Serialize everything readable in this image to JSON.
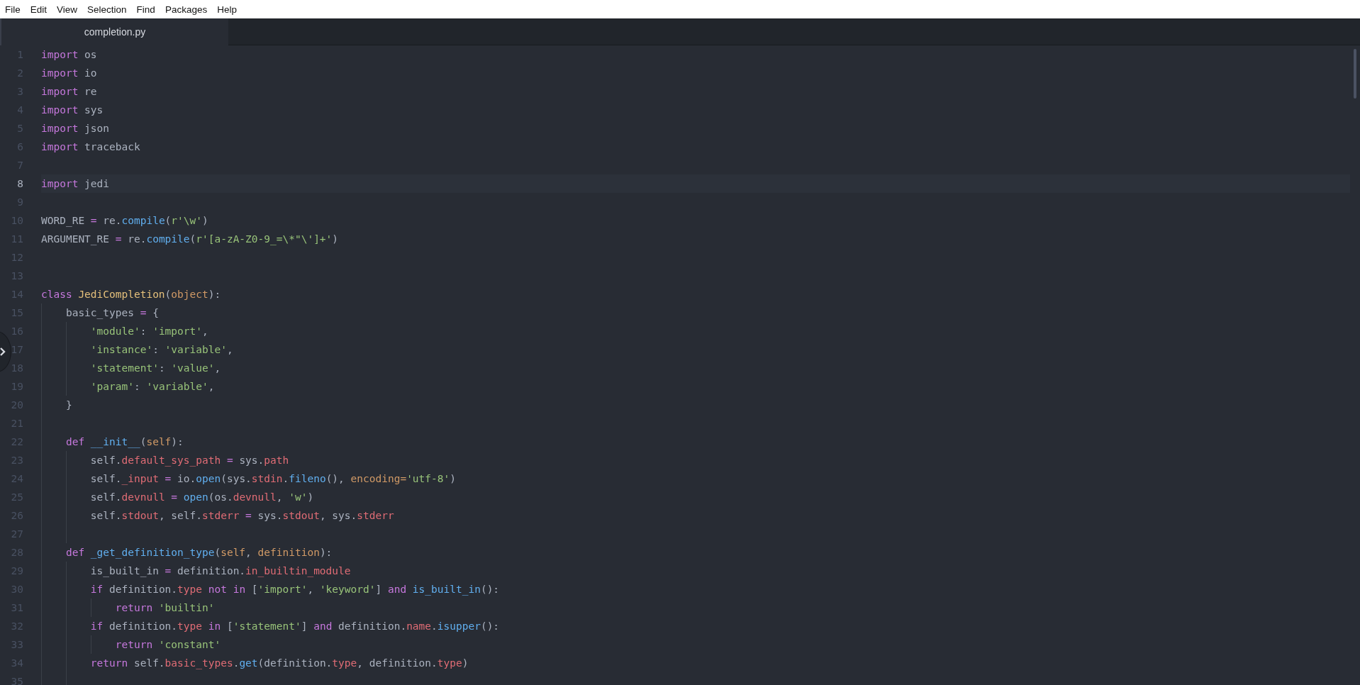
{
  "menu": [
    "File",
    "Edit",
    "View",
    "Selection",
    "Find",
    "Packages",
    "Help"
  ],
  "tabs": [
    {
      "label": "completion.py",
      "selected": true
    }
  ],
  "editor": {
    "lines": [
      {
        "number": "1",
        "current": false,
        "tokens": [
          {
            "text": "import",
            "kind": "keyword"
          },
          {
            "text": " os",
            "kind": "plain"
          }
        ]
      },
      {
        "number": "2",
        "current": false,
        "tokens": [
          {
            "text": "import",
            "kind": "keyword"
          },
          {
            "text": " io",
            "kind": "plain"
          }
        ]
      },
      {
        "number": "3",
        "current": false,
        "tokens": [
          {
            "text": "import",
            "kind": "keyword"
          },
          {
            "text": " re",
            "kind": "plain"
          }
        ]
      },
      {
        "number": "4",
        "current": false,
        "tokens": [
          {
            "text": "import",
            "kind": "keyword"
          },
          {
            "text": " sys",
            "kind": "plain"
          }
        ]
      },
      {
        "number": "5",
        "current": false,
        "tokens": [
          {
            "text": "import",
            "kind": "keyword"
          },
          {
            "text": " json",
            "kind": "plain"
          }
        ]
      },
      {
        "number": "6",
        "current": false,
        "tokens": [
          {
            "text": "import",
            "kind": "keyword"
          },
          {
            "text": " traceback",
            "kind": "plain"
          }
        ]
      },
      {
        "number": "7",
        "current": false
      },
      {
        "number": "8",
        "current": true,
        "tokens": [
          {
            "text": "import",
            "kind": "keyword"
          },
          {
            "text": " jedi",
            "kind": "plain"
          }
        ]
      },
      {
        "number": "9",
        "current": false
      },
      {
        "number": "10",
        "current": false,
        "tokens": [
          {
            "text": "WORD_RE ",
            "kind": "plain"
          },
          {
            "text": "=",
            "kind": "keyword"
          },
          {
            "text": " re.",
            "kind": "plain"
          },
          {
            "text": "compile",
            "kind": "function"
          },
          {
            "text": "(",
            "kind": "plain"
          },
          {
            "text": "r'\\w'",
            "kind": "string"
          },
          {
            "text": ")",
            "kind": "plain"
          }
        ]
      },
      {
        "number": "11",
        "current": false,
        "tokens": [
          {
            "text": "ARGUMENT_RE ",
            "kind": "plain"
          },
          {
            "text": "=",
            "kind": "keyword"
          },
          {
            "text": " re.",
            "kind": "plain"
          },
          {
            "text": "compile",
            "kind": "function"
          },
          {
            "text": "(",
            "kind": "plain"
          },
          {
            "text": "r'[a-zA-Z0-9_=\\*\"\\']+'",
            "kind": "string"
          },
          {
            "text": ")",
            "kind": "plain"
          }
        ]
      },
      {
        "number": "12",
        "current": false
      },
      {
        "number": "13",
        "current": false
      },
      {
        "number": "14",
        "current": false,
        "tokens": [
          {
            "text": "class",
            "kind": "keyword"
          },
          {
            "text": " JediCompletion",
            "kind": "class"
          },
          {
            "text": "(",
            "kind": "plain"
          },
          {
            "text": "object",
            "kind": "param"
          },
          {
            "text": "):",
            "kind": "plain"
          }
        ]
      },
      {
        "number": "15",
        "current": false,
        "tokens": [
          {
            "text": "    basic_types ",
            "kind": "plain"
          },
          {
            "text": "=",
            "kind": "keyword"
          },
          {
            "text": " {",
            "kind": "plain"
          }
        ]
      },
      {
        "number": "16",
        "current": false,
        "tokens": [
          {
            "text": "        'module'",
            "kind": "string"
          },
          {
            "text": ": ",
            "kind": "plain"
          },
          {
            "text": "'import'",
            "kind": "string"
          },
          {
            "text": ",",
            "kind": "plain"
          }
        ]
      },
      {
        "number": "17",
        "current": false,
        "tokens": [
          {
            "text": "        'instance'",
            "kind": "string"
          },
          {
            "text": ": ",
            "kind": "plain"
          },
          {
            "text": "'variable'",
            "kind": "string"
          },
          {
            "text": ",",
            "kind": "plain"
          }
        ]
      },
      {
        "number": "18",
        "current": false,
        "tokens": [
          {
            "text": "        'statement'",
            "kind": "string"
          },
          {
            "text": ": ",
            "kind": "plain"
          },
          {
            "text": "'value'",
            "kind": "string"
          },
          {
            "text": ",",
            "kind": "plain"
          }
        ]
      },
      {
        "number": "19",
        "current": false,
        "tokens": [
          {
            "text": "        'param'",
            "kind": "string"
          },
          {
            "text": ": ",
            "kind": "plain"
          },
          {
            "text": "'variable'",
            "kind": "string"
          },
          {
            "text": ",",
            "kind": "plain"
          }
        ]
      },
      {
        "number": "20",
        "current": false,
        "tokens": [
          {
            "text": "    }",
            "kind": "plain"
          }
        ]
      },
      {
        "number": "21",
        "current": false
      },
      {
        "number": "22",
        "current": false,
        "tokens": [
          {
            "text": "    def",
            "kind": "keyword"
          },
          {
            "text": " __init__",
            "kind": "function"
          },
          {
            "text": "(",
            "kind": "plain"
          },
          {
            "text": "self",
            "kind": "param"
          },
          {
            "text": "):",
            "kind": "plain"
          }
        ]
      },
      {
        "number": "23",
        "current": false,
        "tokens": [
          {
            "text": "        self.",
            "kind": "plain"
          },
          {
            "text": "default_sys_path",
            "kind": "property"
          },
          {
            "text": " =",
            "kind": "keyword"
          },
          {
            "text": " sys.",
            "kind": "plain"
          },
          {
            "text": "path",
            "kind": "property"
          }
        ]
      },
      {
        "number": "24",
        "current": false,
        "tokens": [
          {
            "text": "        self.",
            "kind": "plain"
          },
          {
            "text": "_input",
            "kind": "property"
          },
          {
            "text": " =",
            "kind": "keyword"
          },
          {
            "text": " io.",
            "kind": "plain"
          },
          {
            "text": "open",
            "kind": "function"
          },
          {
            "text": "(sys.",
            "kind": "plain"
          },
          {
            "text": "stdin",
            "kind": "property"
          },
          {
            "text": ".",
            "kind": "plain"
          },
          {
            "text": "fileno",
            "kind": "function"
          },
          {
            "text": "(), ",
            "kind": "plain"
          },
          {
            "text": "encoding=",
            "kind": "param"
          },
          {
            "text": "'utf-8'",
            "kind": "string"
          },
          {
            "text": ")",
            "kind": "plain"
          }
        ]
      },
      {
        "number": "25",
        "current": false,
        "tokens": [
          {
            "text": "        self.",
            "kind": "plain"
          },
          {
            "text": "devnull",
            "kind": "property"
          },
          {
            "text": " =",
            "kind": "keyword"
          },
          {
            "text": " open",
            "kind": "function"
          },
          {
            "text": "(os.",
            "kind": "plain"
          },
          {
            "text": "devnull",
            "kind": "property"
          },
          {
            "text": ", ",
            "kind": "plain"
          },
          {
            "text": "'w'",
            "kind": "string"
          },
          {
            "text": ")",
            "kind": "plain"
          }
        ]
      },
      {
        "number": "26",
        "current": false,
        "tokens": [
          {
            "text": "        self.",
            "kind": "plain"
          },
          {
            "text": "stdout",
            "kind": "property"
          },
          {
            "text": ", self.",
            "kind": "plain"
          },
          {
            "text": "stderr",
            "kind": "property"
          },
          {
            "text": " =",
            "kind": "keyword"
          },
          {
            "text": " sys.",
            "kind": "plain"
          },
          {
            "text": "stdout",
            "kind": "property"
          },
          {
            "text": ", sys.",
            "kind": "plain"
          },
          {
            "text": "stderr",
            "kind": "property"
          }
        ]
      },
      {
        "number": "27",
        "current": false
      },
      {
        "number": "28",
        "current": false,
        "tokens": [
          {
            "text": "    def",
            "kind": "keyword"
          },
          {
            "text": " _get_definition_type",
            "kind": "function"
          },
          {
            "text": "(",
            "kind": "plain"
          },
          {
            "text": "self",
            "kind": "param"
          },
          {
            "text": ", ",
            "kind": "plain"
          },
          {
            "text": "definition",
            "kind": "param"
          },
          {
            "text": "):",
            "kind": "plain"
          }
        ]
      },
      {
        "number": "29",
        "current": false,
        "tokens": [
          {
            "text": "        is_built_in ",
            "kind": "plain"
          },
          {
            "text": "=",
            "kind": "keyword"
          },
          {
            "text": " definition.",
            "kind": "plain"
          },
          {
            "text": "in_builtin_module",
            "kind": "property"
          }
        ]
      },
      {
        "number": "30",
        "current": false,
        "tokens": [
          {
            "text": "        if",
            "kind": "keyword"
          },
          {
            "text": " definition.",
            "kind": "plain"
          },
          {
            "text": "type",
            "kind": "property"
          },
          {
            "text": " not in",
            "kind": "keyword"
          },
          {
            "text": " [",
            "kind": "plain"
          },
          {
            "text": "'import'",
            "kind": "string"
          },
          {
            "text": ", ",
            "kind": "plain"
          },
          {
            "text": "'keyword'",
            "kind": "string"
          },
          {
            "text": "] ",
            "kind": "plain"
          },
          {
            "text": "and",
            "kind": "keyword"
          },
          {
            "text": " is_built_in",
            "kind": "function"
          },
          {
            "text": "():",
            "kind": "plain"
          }
        ]
      },
      {
        "number": "31",
        "current": false,
        "tokens": [
          {
            "text": "            return",
            "kind": "keyword"
          },
          {
            "text": " 'builtin'",
            "kind": "string"
          }
        ]
      },
      {
        "number": "32",
        "current": false,
        "tokens": [
          {
            "text": "        if",
            "kind": "keyword"
          },
          {
            "text": " definition.",
            "kind": "plain"
          },
          {
            "text": "type",
            "kind": "property"
          },
          {
            "text": " in",
            "kind": "keyword"
          },
          {
            "text": " [",
            "kind": "plain"
          },
          {
            "text": "'statement'",
            "kind": "string"
          },
          {
            "text": "] ",
            "kind": "plain"
          },
          {
            "text": "and",
            "kind": "keyword"
          },
          {
            "text": " definition.",
            "kind": "plain"
          },
          {
            "text": "name",
            "kind": "property"
          },
          {
            "text": ".",
            "kind": "plain"
          },
          {
            "text": "isupper",
            "kind": "function"
          },
          {
            "text": "():",
            "kind": "plain"
          }
        ]
      },
      {
        "number": "33",
        "current": false,
        "tokens": [
          {
            "text": "            return",
            "kind": "keyword"
          },
          {
            "text": " 'constant'",
            "kind": "string"
          }
        ]
      },
      {
        "number": "34",
        "current": false,
        "tokens": [
          {
            "text": "        return",
            "kind": "keyword"
          },
          {
            "text": " self.",
            "kind": "plain"
          },
          {
            "text": "basic_types",
            "kind": "property"
          },
          {
            "text": ".",
            "kind": "plain"
          },
          {
            "text": "get",
            "kind": "function"
          },
          {
            "text": "(definition.",
            "kind": "plain"
          },
          {
            "text": "type",
            "kind": "property"
          },
          {
            "text": ", definition.",
            "kind": "plain"
          },
          {
            "text": "type",
            "kind": "property"
          },
          {
            "text": ")",
            "kind": "plain"
          }
        ]
      },
      {
        "number": "35",
        "current": false
      }
    ]
  }
}
